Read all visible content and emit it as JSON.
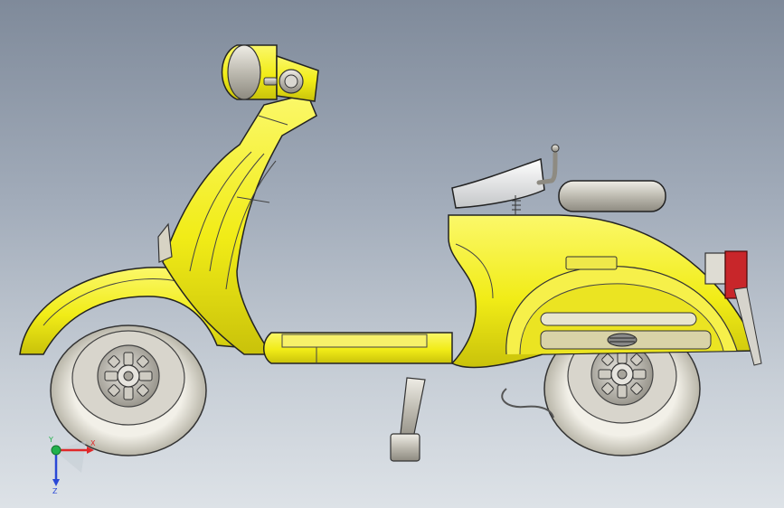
{
  "view": {
    "background_top": "#7f8a9a",
    "background_bottom": "#dde2e7"
  },
  "model": {
    "body_color": "#f4f01e",
    "chrome_color": "#c9c6bc",
    "tire_color": "#e9e7dc",
    "taillight_color": "#c8262a"
  },
  "triad": {
    "x_label": "X",
    "y_label": "Y",
    "z_label": "Z",
    "x_color": "#e0282a",
    "y_color": "#22b14c",
    "z_color": "#2a48d6"
  }
}
